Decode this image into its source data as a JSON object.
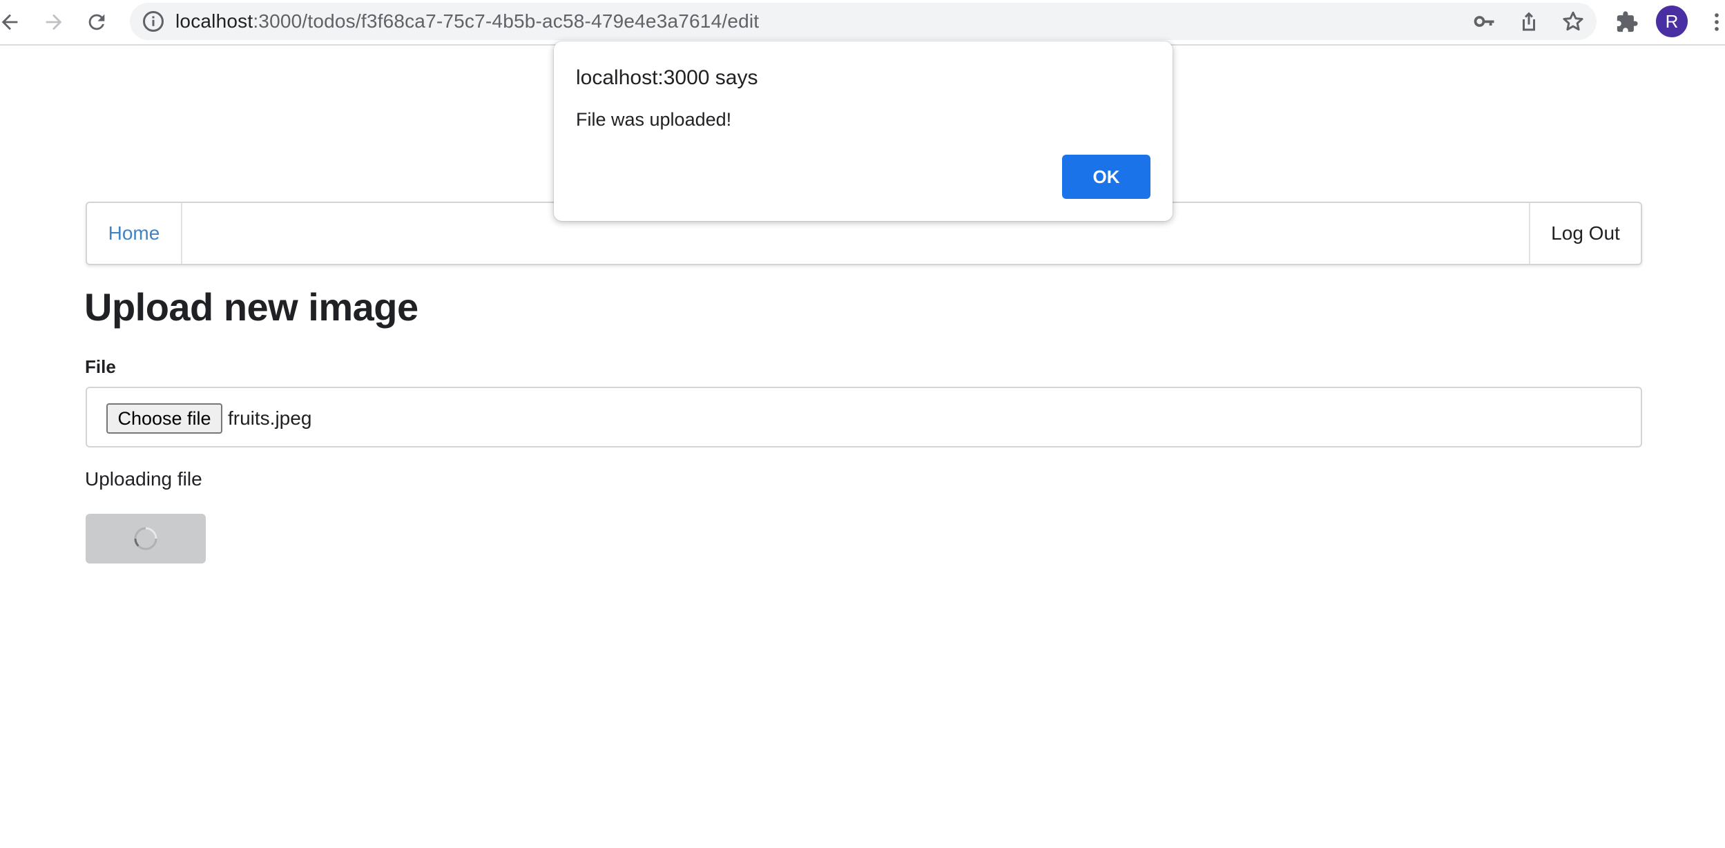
{
  "browser": {
    "url_host": "localhost",
    "url_path": ":3000/todos/f3f68ca7-75c7-4b5b-ac58-479e4e3a7614/edit",
    "profile_initial": "R",
    "icons": [
      "back-icon",
      "forward-icon",
      "reload-icon",
      "info-icon",
      "key-icon",
      "share-icon",
      "star-icon",
      "extensions-icon",
      "menu-icon"
    ]
  },
  "nav": {
    "home_label": "Home",
    "logout_label": "Log Out"
  },
  "main": {
    "title": "Upload new image",
    "file_label": "File",
    "choose_file_label": "Choose file",
    "file_name": "fruits.jpeg",
    "status_text": "Uploading file"
  },
  "dialog": {
    "title": "localhost:3000 says",
    "message": "File was uploaded!",
    "ok_label": "OK"
  },
  "colors": {
    "link": "#4183c4",
    "dialog_ok": "#1a73e8",
    "disabled_button": "#cacbcd",
    "avatar": "#4a2fa3"
  }
}
